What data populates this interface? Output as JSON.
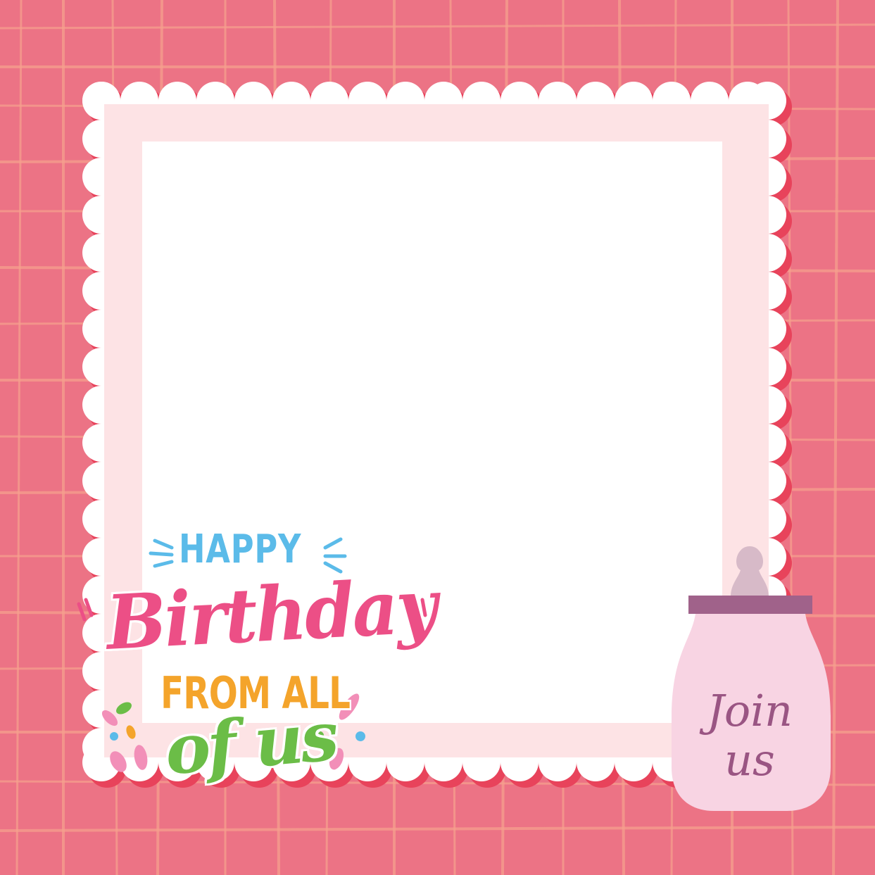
{
  "colors": {
    "background": "#ec7385",
    "plaid_line": "#f6a08e",
    "frame_scallop": "#ffffff",
    "frame_mat": "#fde3e5",
    "photo_area": "#ffffff",
    "happy": "#5bbbe9",
    "birthday": "#ec4f86",
    "from_all": "#f4a42b",
    "of_us": "#6bbd47",
    "bottle_body": "#f8d4e3",
    "bottle_ring": "#a0628a",
    "bottle_nipple": "#d7bac8",
    "bottle_text": "#9a5583"
  },
  "greeting": {
    "line1": "HAPPY",
    "line2": "Birthday",
    "line3": "FROM ALL",
    "line4": "of us"
  },
  "bottle": {
    "icon": "baby-bottle-icon",
    "label_line1": "Join",
    "label_line2": "us"
  }
}
